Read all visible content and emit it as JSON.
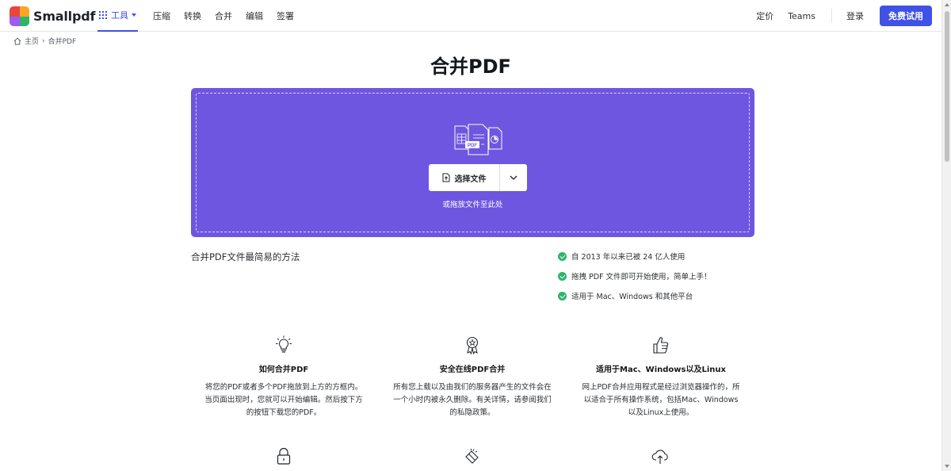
{
  "header": {
    "logo_text": "Smallpdf",
    "nav": {
      "tools_label": "工具",
      "items": [
        "压缩",
        "转换",
        "合并",
        "编辑",
        "签署"
      ]
    },
    "pricing_label": "定价",
    "teams_label": "Teams",
    "login_label": "登录",
    "trial_label": "免费试用",
    "brand_color": "#3f51e6"
  },
  "breadcrumb": {
    "home_label": "主页",
    "separator": "›",
    "current_label": "合并PDF"
  },
  "page_title": "合并PDF",
  "dropzone": {
    "choose_label": "选择文件",
    "hint": "或拖放文件至此处",
    "color": "#6e56e0"
  },
  "easy_text": "合并PDF文件最简易的方法",
  "features": [
    "自 2013 年以来已被 24 亿人使用",
    "拖拽 PDF 文件即可开始使用，简单上手！",
    "适用于 Mac、Windows 和其他平台"
  ],
  "info_cards": [
    {
      "icon": "lightbulb-icon",
      "title": "如何合并PDF",
      "text": "将您的PDF或者多个PDF拖放到上方的方框内。当页面出现时，您就可以开始编辑。然后按下方的按钮下载您的PDF。"
    },
    {
      "icon": "award-icon",
      "title": "安全在线PDF合并",
      "text": "所有您上载以及由我们的服务器产生的文件会在一个小时内被永久删除。有关详情，请参阅我们的私隐政策。"
    },
    {
      "icon": "thumbs-up-icon",
      "title": "适用于Mac、Windows以及Linux",
      "text": "网上PDF合并应用程式是经过浏览器操作的，所以适合于所有操作系统，包括Mac、Windows以及Linux上使用。"
    }
  ],
  "bottom_icons": [
    "lock-icon",
    "magic-wand-icon",
    "cloud-upload-icon"
  ]
}
